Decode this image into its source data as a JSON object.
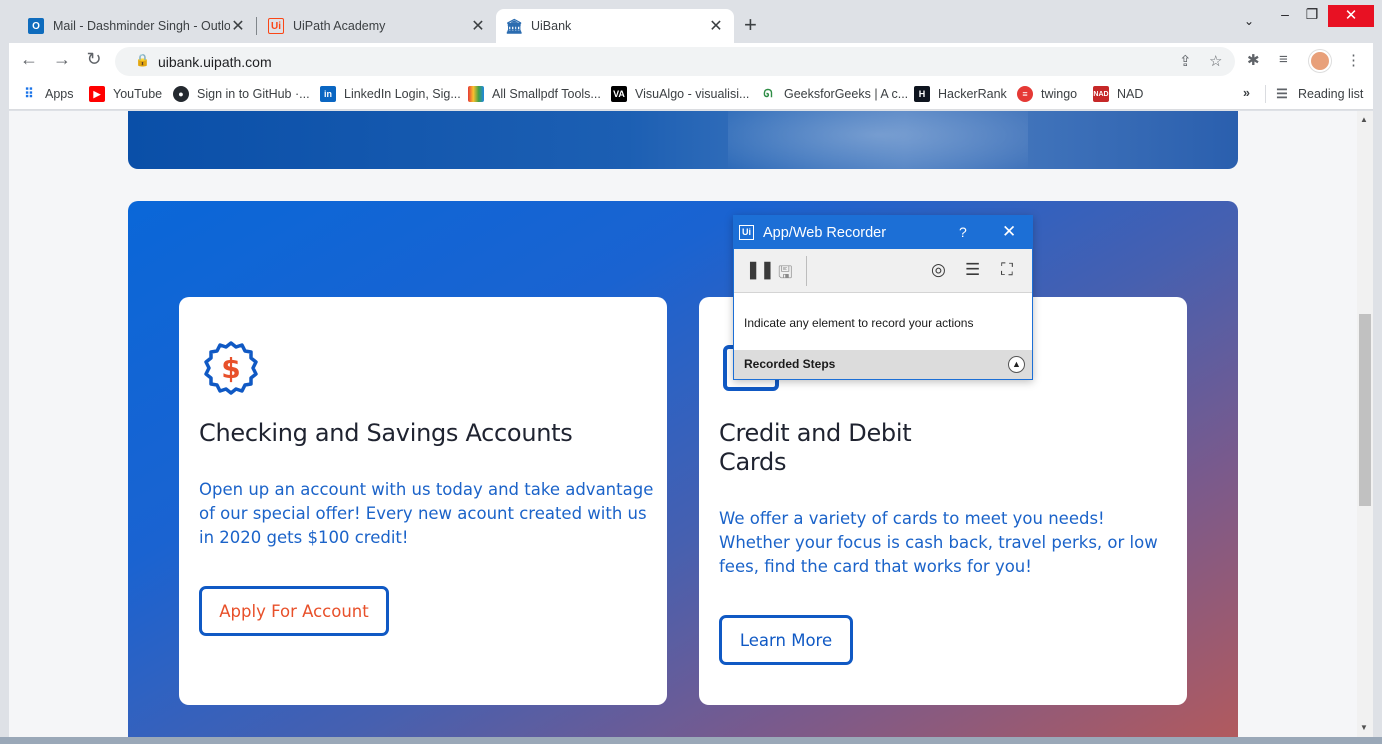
{
  "browser": {
    "tabs": [
      {
        "title": "Mail - Dashminder Singh - Outlo",
        "icon": "outlook-icon",
        "color": "#0f6cbd"
      },
      {
        "title": "UiPath Academy",
        "icon": "uipath-icon",
        "color": "#fa4616"
      },
      {
        "title": "UiBank",
        "icon": "bank-icon",
        "color": "#2b6cb0",
        "active": true
      }
    ],
    "url": "uibank.uipath.com",
    "bookmarks": [
      {
        "label": "Apps",
        "icon": "apps-grid-icon"
      },
      {
        "label": "YouTube",
        "icon": "youtube-icon",
        "color": "#ff0000"
      },
      {
        "label": "Sign in to GitHub ·...",
        "icon": "github-icon",
        "color": "#24292f"
      },
      {
        "label": "LinkedIn Login, Sig...",
        "icon": "linkedin-icon",
        "color": "#0a66c2"
      },
      {
        "label": "All Smallpdf Tools...",
        "icon": "smallpdf-icon"
      },
      {
        "label": "VisuAlgo - visualisi...",
        "icon": "visualgo-icon",
        "color": "#000000"
      },
      {
        "label": "GeeksforGeeks | A c...",
        "icon": "geeksforgeeks-icon",
        "color": "#2f8d46"
      },
      {
        "label": "HackerRank",
        "icon": "hackerrank-icon",
        "color": "#0e141e"
      },
      {
        "label": "twingo",
        "icon": "twingo-icon",
        "color": "#e53935"
      },
      {
        "label": "NAD",
        "icon": "nad-icon",
        "color": "#c62828"
      }
    ],
    "more_bookmarks": "»",
    "reading_list": "Reading list"
  },
  "cards": [
    {
      "title": "Checking and Savings Accounts",
      "description": "Open up an account with us today and take advantage of our special offer! Every new acount created with us in 2020 gets $100 credit!",
      "button": "Apply For Account",
      "icon": "dollar-badge-icon"
    },
    {
      "title_line1": "Credit and Debit",
      "title_line2": "Cards",
      "description": "We offer a variety of cards to meet you needs! Whether your focus is cash back, travel perks, or low fees, find the card that works for you!",
      "button": "Learn More",
      "icon": "card-icon"
    }
  ],
  "recorder": {
    "title": "App/Web Recorder",
    "help": "?",
    "hint": "Indicate any element to record your actions",
    "steps_label": "Recorded Steps",
    "accent": "#1c6fd6"
  },
  "colors": {
    "brand_blue": "#1059c4",
    "button_orange": "#e8502a",
    "panel_start": "#0a67d8",
    "panel_end": "#b65a5a"
  }
}
